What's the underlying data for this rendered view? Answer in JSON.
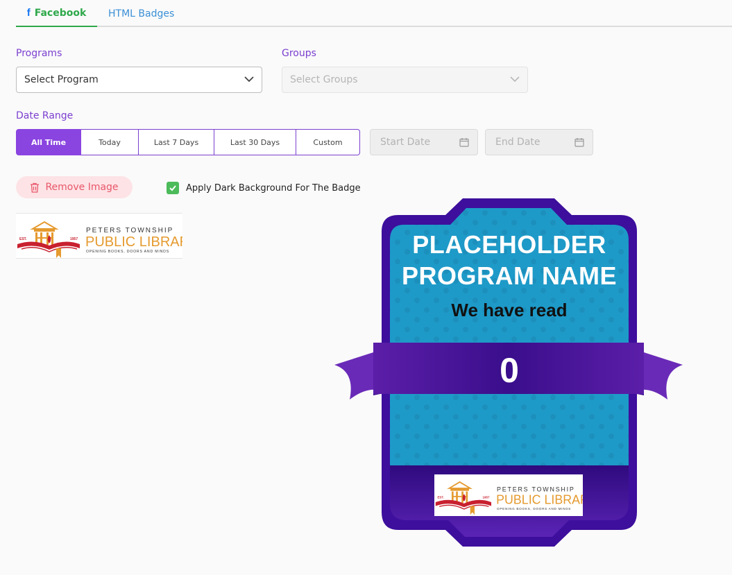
{
  "tabs": {
    "facebook_icon": "f",
    "facebook": "Facebook",
    "html_badges": "HTML Badges"
  },
  "programs": {
    "label": "Programs",
    "value": "Select Program"
  },
  "groups": {
    "label": "Groups",
    "placeholder": "Select Groups"
  },
  "date_range": {
    "label": "Date Range",
    "options": [
      "All Time",
      "Today",
      "Last 7 Days",
      "Last 30 Days",
      "Custom"
    ],
    "selected": "All Time",
    "start_placeholder": "Start Date",
    "end_placeholder": "End Date"
  },
  "remove_image": "Remove Image",
  "dark_background": {
    "label": "Apply Dark Background For The Badge",
    "checked": true
  },
  "logo": {
    "name_top": "PETERS TOWNSHIP",
    "name_main": "PUBLIC LIBRARY",
    "tagline": "OPENING BOOKS, DOORS AND MINDS",
    "est": "EST.",
    "year": "1957"
  },
  "badge": {
    "title_line1": "PLACEHOLDER",
    "title_line2": "PROGRAM NAME",
    "subtitle": "We have read",
    "count": "0"
  },
  "colors": {
    "accent_purple": "#8a44e0",
    "tab_green": "#2ea84a",
    "badge_blue": "#1e9ac8",
    "badge_purple": "#3f0f96",
    "remove_red": "#e8576a"
  }
}
